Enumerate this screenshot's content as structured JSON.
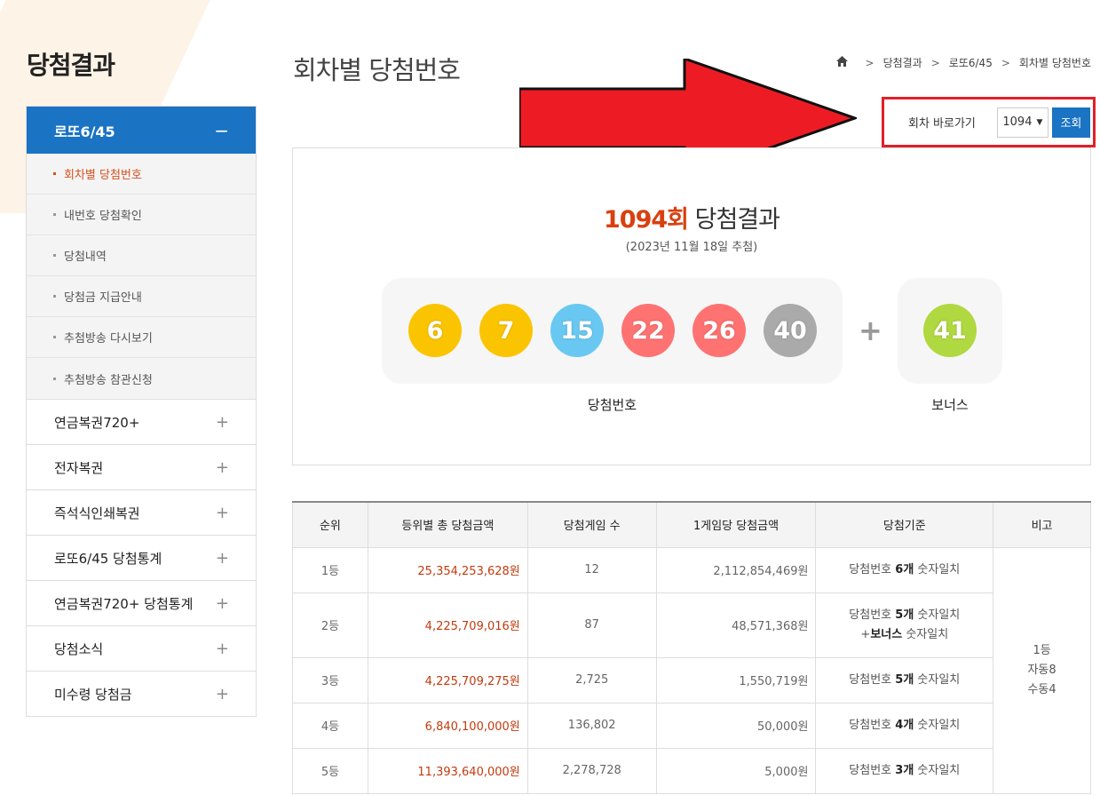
{
  "sidebar": {
    "title": "당첨결과",
    "active": {
      "label": "로또6/45",
      "sign": "−"
    },
    "sub_items": [
      {
        "label": "회차별 당첨번호"
      },
      {
        "label": "내번호 당첨확인"
      },
      {
        "label": "당첨내역"
      },
      {
        "label": "당첨금 지급안내"
      },
      {
        "label": "추첨방송 다시보기"
      },
      {
        "label": "추첨방송 참관신청"
      }
    ],
    "items": [
      {
        "label": "연금복권720+",
        "sign": "+"
      },
      {
        "label": "전자복권",
        "sign": "+"
      },
      {
        "label": "즉석식인쇄복권",
        "sign": "+"
      },
      {
        "label": "로또6/45 당첨통계",
        "sign": "+"
      },
      {
        "label": "연금복권720+ 당첨통계",
        "sign": "+"
      },
      {
        "label": "당첨소식",
        "sign": "+"
      },
      {
        "label": "미수령 당첨금",
        "sign": "+"
      }
    ]
  },
  "header": {
    "title": "회차별 당첨번호",
    "breadcrumb": [
      "당첨결과",
      "로또6/45",
      "회차별 당첨번호"
    ],
    "home_icon": "home-icon"
  },
  "jump": {
    "label": "회차 바로가기",
    "selected": "1094",
    "button": "조회"
  },
  "result": {
    "round": "1094회",
    "title_suffix": " 당첨결과",
    "date": "(2023년 11월 18일 추첨)",
    "numbers": [
      {
        "value": "6",
        "color": "#fbc400"
      },
      {
        "value": "7",
        "color": "#fbc400"
      },
      {
        "value": "15",
        "color": "#69c8f2"
      },
      {
        "value": "22",
        "color": "#ff7272"
      },
      {
        "value": "26",
        "color": "#ff7272"
      },
      {
        "value": "40",
        "color": "#aaaaaa"
      }
    ],
    "plus": "+",
    "bonus": {
      "value": "41",
      "color": "#b0d840"
    },
    "win_label": "당첨번호",
    "bonus_label": "보너스"
  },
  "table": {
    "headers": [
      "순위",
      "등위별 총 당첨금액",
      "당첨게임 수",
      "1게임당 당첨금액",
      "당첨기준",
      "비고"
    ],
    "rows": [
      {
        "rank": "1등",
        "total": "25,354,253,628원",
        "count": "12",
        "per": "2,112,854,469원",
        "crit_pre": "당첨번호 ",
        "crit_bold": "6개",
        "crit_post": " 숫자일치"
      },
      {
        "rank": "2등",
        "total": "4,225,709,016원",
        "count": "87",
        "per": "48,571,368원",
        "crit_pre": "당첨번호 ",
        "crit_bold": "5개",
        "crit_post": " 숫자일치",
        "crit2_pre": "+",
        "crit2_bold": "보너스",
        "crit2_post": " 숫자일치"
      },
      {
        "rank": "3등",
        "total": "4,225,709,275원",
        "count": "2,725",
        "per": "1,550,719원",
        "crit_pre": "당첨번호 ",
        "crit_bold": "5개",
        "crit_post": " 숫자일치"
      },
      {
        "rank": "4등",
        "total": "6,840,100,000원",
        "count": "136,802",
        "per": "50,000원",
        "crit_pre": "당첨번호 ",
        "crit_bold": "4개",
        "crit_post": " 숫자일치"
      },
      {
        "rank": "5등",
        "total": "11,393,640,000원",
        "count": "2,278,728",
        "per": "5,000원",
        "crit_pre": "당첨번호 ",
        "crit_bold": "3개",
        "crit_post": " 숫자일치"
      }
    ],
    "note": [
      "1등",
      "자동8",
      "수동4"
    ]
  },
  "annotation": {
    "arrow_color": "#ed1c24",
    "box_color": "#e0202a"
  }
}
